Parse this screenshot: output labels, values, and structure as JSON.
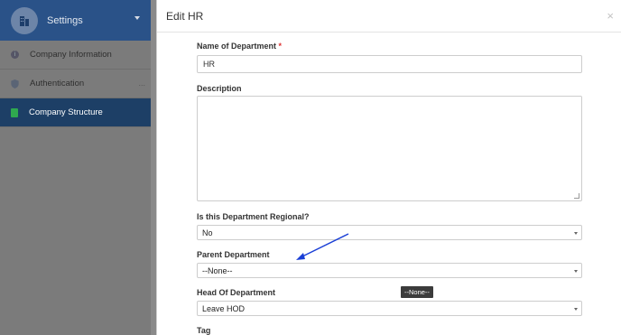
{
  "sidebar": {
    "title": "Settings",
    "items": [
      {
        "label": "Company Information",
        "icon": "info-icon"
      },
      {
        "label": "Authentication",
        "icon": "shield-icon",
        "extra": "..."
      },
      {
        "label": "Company Structure",
        "icon": "book-icon"
      }
    ]
  },
  "modal": {
    "title": "Edit HR",
    "close_glyph": "×",
    "fields": {
      "name_label": "Name of Department",
      "required_mark": "*",
      "name_value": "HR",
      "description_label": "Description",
      "regional_label": "Is this Department Regional?",
      "regional_value": "No",
      "parent_label": "Parent Department",
      "parent_value": "--None--",
      "hod_label": "Head Of Department",
      "hod_value": "Leave HOD",
      "tag_label": "Tag"
    },
    "tooltip": "--None--"
  },
  "colors": {
    "sidebar_header": "#2a5288",
    "sidebar_active": "#1d3f66",
    "annotation_arrow": "#1a3fd6",
    "required": "#dd3333"
  }
}
